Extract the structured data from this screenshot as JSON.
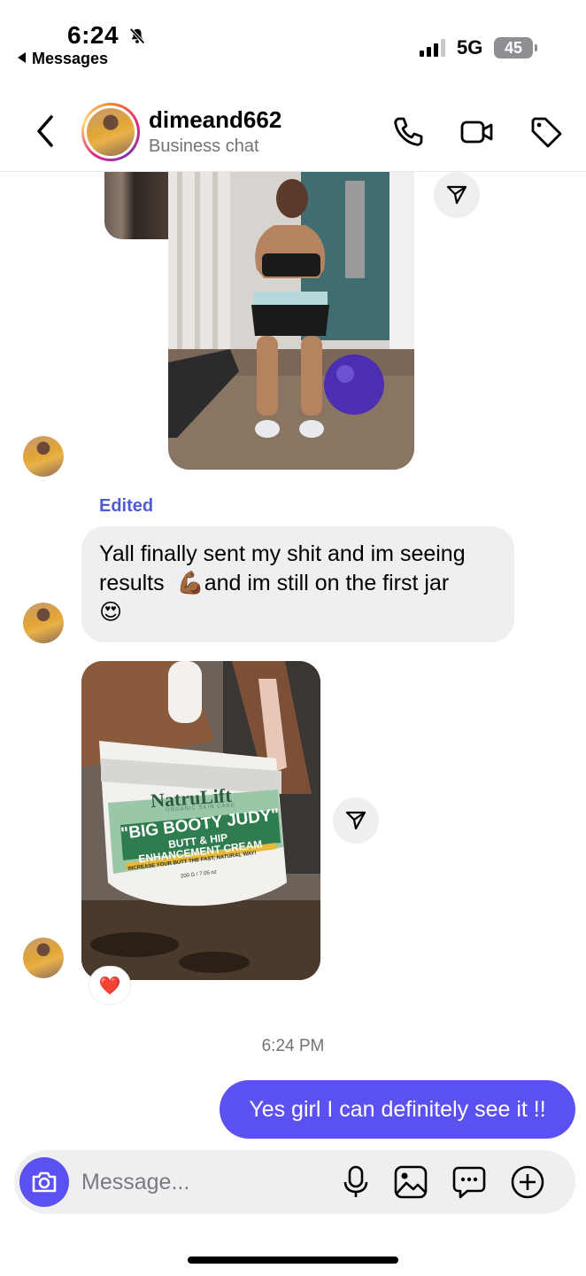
{
  "status_bar": {
    "time": "6:24",
    "back_app": "Messages",
    "network": "5G",
    "battery": "45"
  },
  "header": {
    "username": "dimeand662",
    "subtitle": "Business chat"
  },
  "messages": {
    "edited_label": "Edited",
    "text_line_1": "Yall finally sent my shit and im seeing",
    "text_line_2a": "results",
    "text_line_2b": "and im still on the first jar",
    "emoji_flex": "💪🏾",
    "emoji_heart_eyes": "😍",
    "product": {
      "brand": "NatruLift",
      "tagline": "ORGANIC SKIN CARE",
      "name": "\"BIG BOOTY JUDY\"",
      "desc_1": "BUTT & HIP",
      "desc_2": "ENHANCEMENT CREAM",
      "strap": "INCREASE YOUR BUTT THE FAST, NATURAL WAY!",
      "weight": "200 G / 7.05 oz"
    },
    "reaction": "❤️",
    "timestamp": "6:24 PM",
    "outgoing": "Yes girl I can definitely see it !!"
  },
  "composer": {
    "placeholder": "Message..."
  },
  "icons": {
    "back": "chevron-left-icon",
    "call": "phone-icon",
    "video": "video-camera-icon",
    "tag": "tag-icon",
    "share": "send-icon",
    "camera": "camera-icon",
    "mic": "microphone-icon",
    "gallery": "image-icon",
    "sticker": "chat-bubble-icon",
    "more": "plus-circle-icon"
  },
  "colors": {
    "accent": "#5b51f0",
    "edited": "#4f5bd5",
    "bubble_in": "#efeff1"
  }
}
